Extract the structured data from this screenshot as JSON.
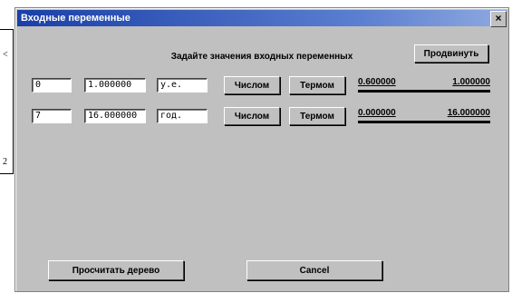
{
  "background": {
    "mark_top": "<",
    "mark_bottom": "2"
  },
  "dialog": {
    "title": "Входные переменные",
    "close_glyph": "×",
    "prompt": "Задайте значения входных переменных",
    "prompt_button": "Продвинуть",
    "rows": [
      {
        "index": "0",
        "value": "1.000000",
        "unit": "у.е.",
        "numeric_label": "Числом",
        "term_label": "Термом",
        "range_min": "0.600000",
        "range_max": "1.000000"
      },
      {
        "index": "7",
        "value": "16.000000",
        "unit": "год.",
        "numeric_label": "Числом",
        "term_label": "Термом",
        "range_min": "0.000000",
        "range_max": "16.000000"
      }
    ],
    "compute_label": "Просчитать дерево",
    "cancel_label": "Cancel"
  }
}
